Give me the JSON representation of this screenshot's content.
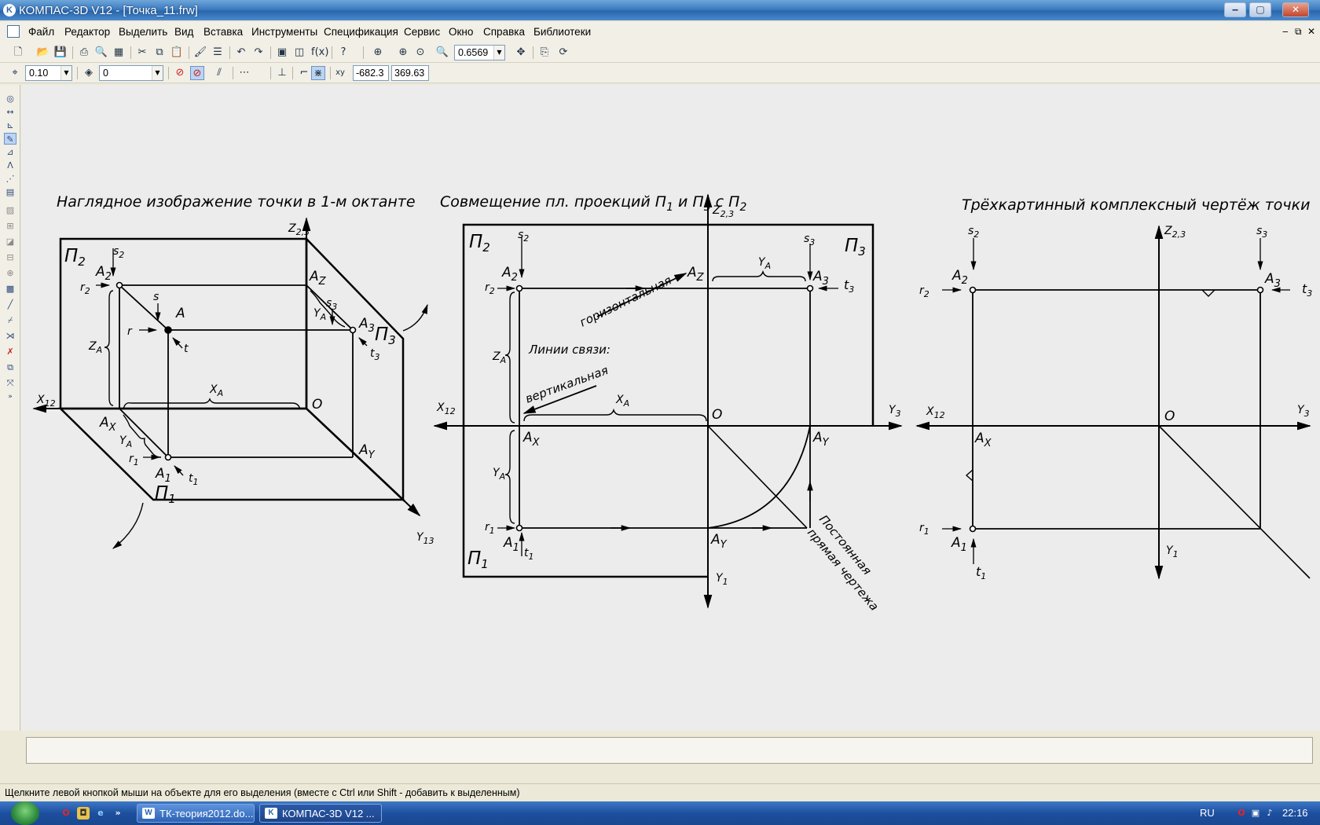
{
  "window": {
    "title": "КОМПАС-3D V12 - [Точка_11.frw]",
    "minimize": "‒",
    "maximize": "▢",
    "close": "✕"
  },
  "menu": {
    "items": [
      "Файл",
      "Редактор",
      "Выделить",
      "Вид",
      "Вставка",
      "Инструменты",
      "Спецификация",
      "Сервис",
      "Окно",
      "Справка",
      "Библиотеки"
    ],
    "doc_controls": [
      "‒",
      "⧉",
      "✕"
    ]
  },
  "toolbar1": {
    "zoom_value": "0.6569"
  },
  "toolbar2": {
    "step_value": "0.10",
    "layer_value": "0",
    "coord_x": "-682.3",
    "coord_y": "369.63"
  },
  "drawing": {
    "title1": "Наглядное изображение точки в 1-м октанте",
    "title2": "Совмещение пл. проекций П",
    "title2_sub1": "1",
    "title2_mid": " и П",
    "title2_sub2": "3",
    "title2_end": " с П",
    "title2_sub3": "2",
    "title3": "Трёхкартинный комплексный чертёж точки",
    "label_horizontal": "горизонтальная",
    "label_links": "Линии связи:",
    "label_vertical": "вертикальная",
    "label_const1": "Постоянная",
    "label_const2": "прямая чертежа"
  },
  "status": {
    "text": "Щелкните левой кнопкой мыши на объекте для его выделения (вместе с Ctrl или Shift - добавить к выделенным)"
  },
  "taskbar": {
    "tasks": [
      "ТК-теория2012.do...",
      "КОМПАС-3D V12 ..."
    ],
    "lang": "RU",
    "time": "22:16"
  }
}
